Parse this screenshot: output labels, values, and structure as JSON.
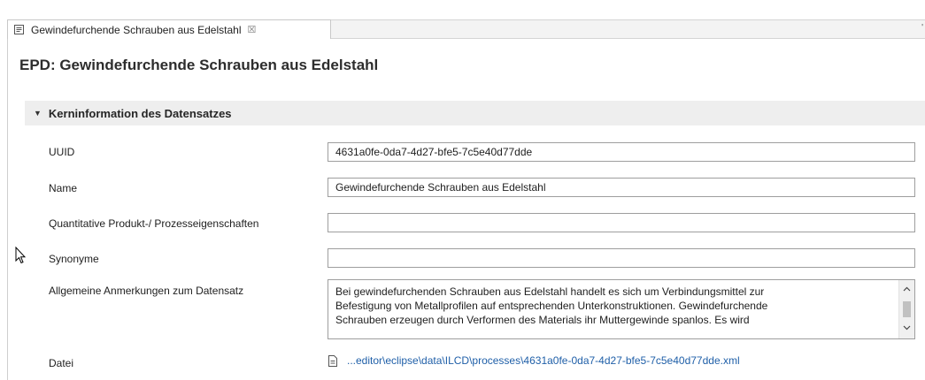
{
  "editor_tab": {
    "title": "Gewindefurchende Schrauben aus Edelstahl",
    "close_glyph": "☒",
    "right_mark": "'"
  },
  "page": {
    "title": "EPD: Gewindefurchende Schrauben aus Edelstahl"
  },
  "section": {
    "title": "Kerninformation des Datensatzes",
    "expanded": true
  },
  "fields": {
    "uuid": {
      "label": "UUID",
      "value": "4631a0fe-0da7-4d27-bfe5-7c5e40d77dde"
    },
    "name": {
      "label": "Name",
      "value": "Gewindefurchende Schrauben aus Edelstahl"
    },
    "quantitative": {
      "label": "Quantitative Produkt-/ Prozesseigenschaften",
      "value": ""
    },
    "synonyme": {
      "label": "Synonyme",
      "value": ""
    },
    "anmerkungen": {
      "label": "Allgemeine Anmerkungen zum Datensatz",
      "line1": "Bei gewindefurchenden Schrauben aus Edelstahl handelt es sich um Verbindungsmittel zur",
      "line2": "Befestigung von Metallprofilen auf entsprechenden Unterkonstruktionen. Gewindefurchende",
      "line3": "Schrauben erzeugen durch Verformen des Materials ihr Muttergewinde spanlos. Es wird"
    },
    "datei": {
      "label": "Datei",
      "link": "...editor\\eclipse\\data\\ILCD\\processes\\4631a0fe-0da7-4d27-bfe5-7c5e40d77dde.xml"
    }
  },
  "icons": {
    "tab_icon": "document-editor-icon",
    "section_toggle": "triangle-down-icon",
    "file_icon": "document-icon",
    "scroll_up": "chevron-up-icon",
    "scroll_down": "chevron-down-icon",
    "cursor": "mouse-pointer-icon"
  },
  "colors": {
    "link": "#1f5fa8",
    "section_bg": "#eeeeee",
    "input_border": "#9e9e9e"
  }
}
